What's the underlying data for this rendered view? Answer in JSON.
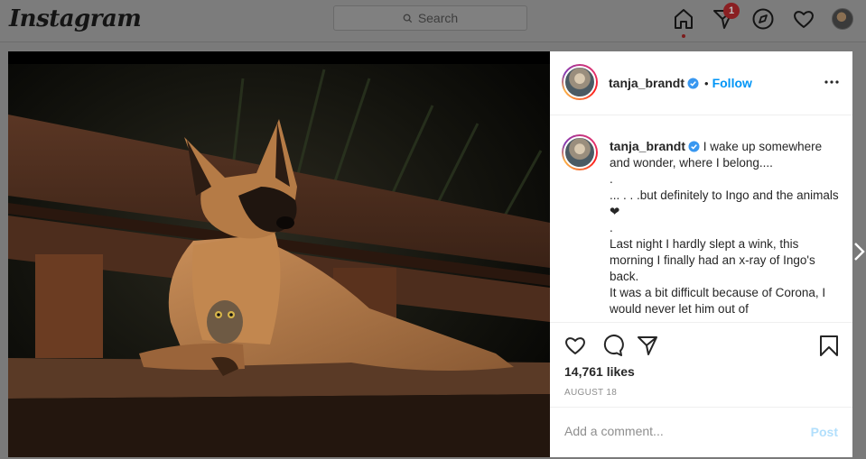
{
  "topbar": {
    "logo": "Instagram",
    "search_placeholder": "Search",
    "notification_count": "1",
    "icons": [
      "search-icon",
      "home-icon",
      "direct-icon",
      "explore-icon",
      "heart-icon",
      "profile-avatar"
    ]
  },
  "post": {
    "username": "tanja_brandt",
    "follow_label": "Follow",
    "dot": "•",
    "caption_lines": [
      "I wake up somewhere and wonder, where I belong....",
      ".",
      "... . . .but definitely to Ingo and the animals ❤",
      ".",
      "Last night I hardly slept a wink, this morning I finally had an x-ray of Ingo's back.",
      "It was a bit difficult because of Corona, I would never let him out of"
    ],
    "likes": "14,761 likes",
    "date": "AUGUST 18",
    "comment_placeholder": "Add a comment...",
    "post_label": "Post",
    "icons": [
      "heart-outline-icon",
      "comment-icon",
      "share-icon",
      "bookmark-icon",
      "more-options-icon",
      "verified-badge-icon"
    ]
  },
  "colors": {
    "accent": "#0095f6",
    "post_disabled": "#b2dffc",
    "overlay": "#7a7a7a"
  }
}
